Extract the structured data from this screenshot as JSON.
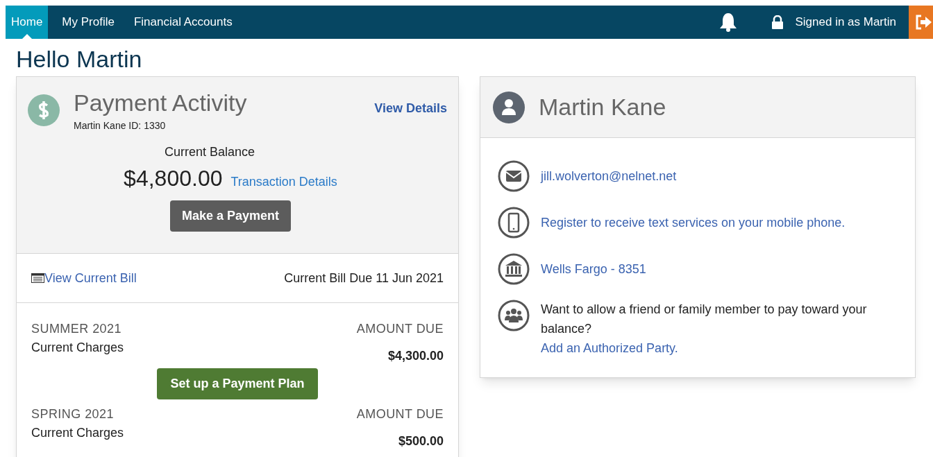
{
  "nav": {
    "tabs": [
      {
        "label": "Home",
        "selected": true
      },
      {
        "label": "My Profile",
        "selected": false
      },
      {
        "label": "Financial Accounts",
        "selected": false
      }
    ],
    "signed_in": "Signed in as Martin"
  },
  "greeting": "Hello Martin",
  "payment_activity": {
    "title": "Payment Activity",
    "subtitle": "Martin Kane ID: 1330",
    "view_details": "View Details",
    "balance_label": "Current Balance",
    "balance": "$4,800.00",
    "transaction_details": "Transaction Details",
    "pay_button": "Make a Payment",
    "view_bill": "View Current Bill",
    "bill_due": "Current Bill Due 11 Jun 2021",
    "terms": [
      {
        "term": "SUMMER 2021",
        "charges": "Current Charges",
        "amount_label": "AMOUNT DUE",
        "amount": "$4,300.00",
        "plan_button": "Set up a Payment Plan"
      },
      {
        "term": "SPRING 2021",
        "charges": "Current Charges",
        "amount_label": "AMOUNT DUE",
        "amount": "$500.00"
      }
    ]
  },
  "profile": {
    "name": "Martin Kane",
    "items": [
      {
        "kind": "email",
        "link": "jill.wolverton@nelnet.net"
      },
      {
        "kind": "phone",
        "link": "Register to receive text services on your mobile phone."
      },
      {
        "kind": "bank",
        "link": "Wells Fargo - 8351"
      },
      {
        "kind": "party",
        "text": "Want to allow a friend or family member to pay toward your balance?",
        "link": "Add an Authorized Party."
      }
    ]
  }
}
